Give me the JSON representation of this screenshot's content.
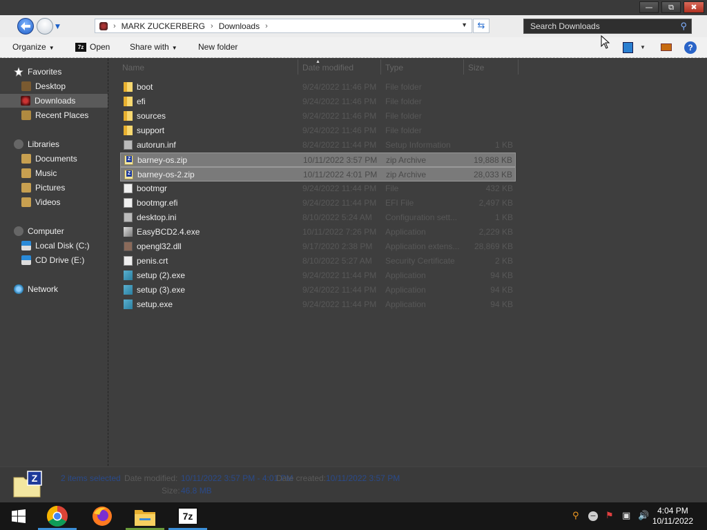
{
  "window": {
    "address": {
      "segments": [
        "MARK ZUCKERBERG",
        "Downloads"
      ]
    },
    "search": {
      "placeholder": "Search Downloads"
    }
  },
  "toolbar": {
    "organize": "Organize",
    "open": "Open",
    "share_with": "Share with",
    "new_folder": "New folder"
  },
  "nav": {
    "favorites": "Favorites",
    "desktop": "Desktop",
    "downloads": "Downloads",
    "recent_places": "Recent Places",
    "libraries": "Libraries",
    "documents": "Documents",
    "music": "Music",
    "pictures": "Pictures",
    "videos": "Videos",
    "computer": "Computer",
    "local_disk": "Local Disk (C:)",
    "cd_drive": "CD Drive (E:)",
    "network": "Network"
  },
  "columns": {
    "name": "Name",
    "date": "Date modified",
    "type": "Type",
    "size": "Size"
  },
  "files": [
    {
      "name": "boot",
      "date": "9/24/2022 11:46 PM",
      "type": "File folder",
      "size": "",
      "icon": "folder-icon"
    },
    {
      "name": "efi",
      "date": "9/24/2022 11:46 PM",
      "type": "File folder",
      "size": "",
      "icon": "folder-icon"
    },
    {
      "name": "sources",
      "date": "9/24/2022 11:46 PM",
      "type": "File folder",
      "size": "",
      "icon": "folder-icon"
    },
    {
      "name": "support",
      "date": "9/24/2022 11:46 PM",
      "type": "File folder",
      "size": "",
      "icon": "folder-icon"
    },
    {
      "name": "autorun.inf",
      "date": "8/24/2022 11:44 PM",
      "type": "Setup Information",
      "size": "1 KB",
      "icon": "settings-file-icon"
    },
    {
      "name": "barney-os.zip",
      "date": "10/11/2022 3:57 PM",
      "type": "zip Archive",
      "size": "19,888 KB",
      "icon": "zip-icon",
      "selected": true
    },
    {
      "name": "barney-os-2.zip",
      "date": "10/11/2022 4:01 PM",
      "type": "zip Archive",
      "size": "28,033 KB",
      "icon": "zip-icon",
      "selected": true
    },
    {
      "name": "bootmgr",
      "date": "9/24/2022 11:44 PM",
      "type": "File",
      "size": "432 KB",
      "icon": "file-icon"
    },
    {
      "name": "bootmgr.efi",
      "date": "9/24/2022 11:44 PM",
      "type": "EFI File",
      "size": "2,497 KB",
      "icon": "file-icon"
    },
    {
      "name": "desktop.ini",
      "date": "8/10/2022 5:24 AM",
      "type": "Configuration sett...",
      "size": "1 KB",
      "icon": "settings-file-icon"
    },
    {
      "name": "EasyBCD2.4.exe",
      "date": "10/11/2022 7:26 PM",
      "type": "Application",
      "size": "2,229 KB",
      "icon": "app-icon"
    },
    {
      "name": "opengl32.dll",
      "date": "9/17/2020 2:38 PM",
      "type": "Application extens...",
      "size": "28,869 KB",
      "icon": "dll-icon"
    },
    {
      "name": "penis.crt",
      "date": "8/10/2022 5:27 AM",
      "type": "Security Certificate",
      "size": "2 KB",
      "icon": "certificate-icon"
    },
    {
      "name": "setup (2).exe",
      "date": "9/24/2022 11:44 PM",
      "type": "Application",
      "size": "94 KB",
      "icon": "setup-icon"
    },
    {
      "name": "setup (3).exe",
      "date": "9/24/2022 11:44 PM",
      "type": "Application",
      "size": "94 KB",
      "icon": "setup-icon"
    },
    {
      "name": "setup.exe",
      "date": "9/24/2022 11:44 PM",
      "type": "Application",
      "size": "94 KB",
      "icon": "setup-icon"
    }
  ],
  "details": {
    "title": "2 items selected",
    "date_modified_label": "Date modified:",
    "date_modified_value": "10/11/2022 3:57 PM - 4:01 PM",
    "date_created_label": "Date created:",
    "date_created_value": "10/11/2022 3:57 PM",
    "size_label": "Size:",
    "size_value": "46.8 MB"
  },
  "taskbar": {
    "time": "4:04 PM",
    "date": "10/11/2022",
    "apps": [
      "chrome-icon",
      "firefox-icon",
      "file-explorer-icon",
      "7zip-icon"
    ]
  },
  "colors": {
    "selection": "#7a7a7a",
    "accent": "#1f5fc8"
  }
}
